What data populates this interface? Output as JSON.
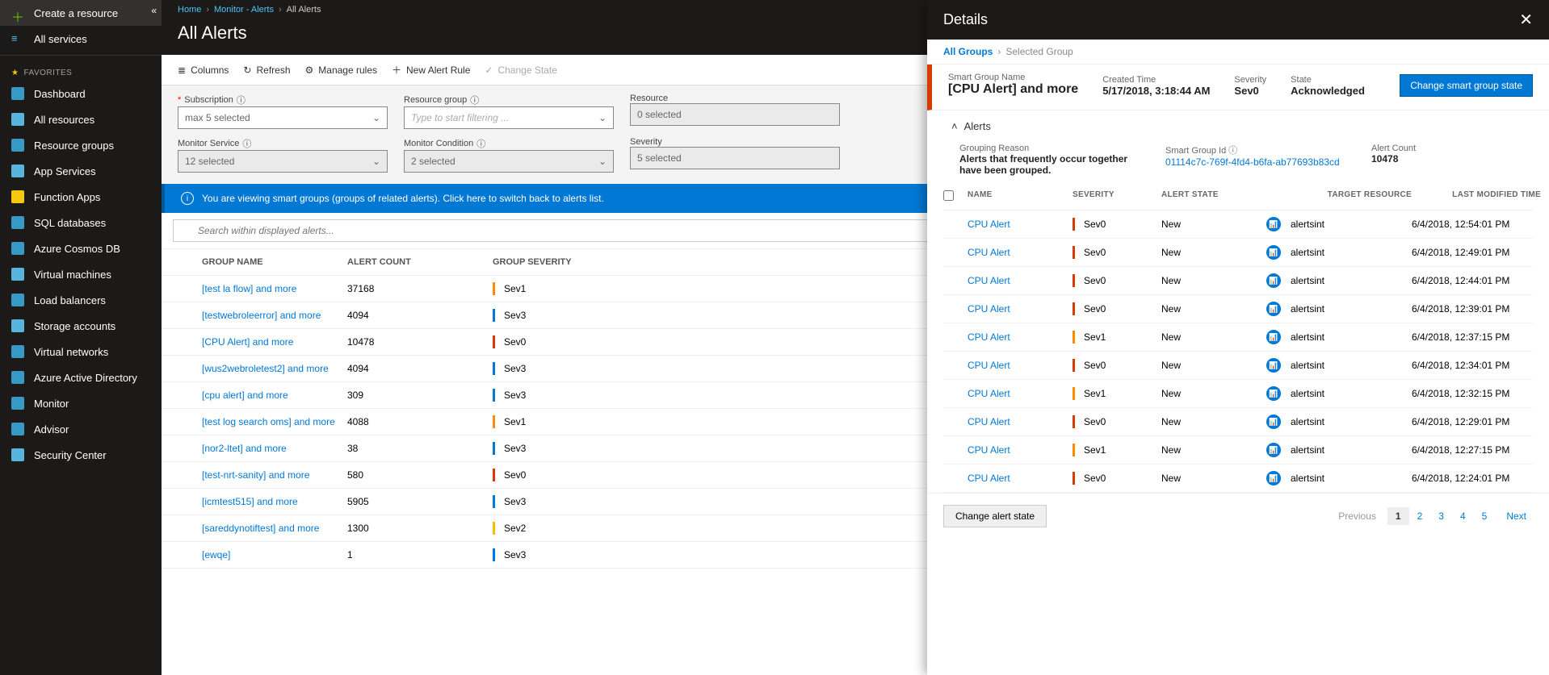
{
  "sidebar": {
    "create": "Create a resource",
    "all_services": "All services",
    "favorites": "FAVORITES",
    "items": [
      {
        "label": "Dashboard",
        "icon": "dashboard"
      },
      {
        "label": "All resources",
        "icon": "allres"
      },
      {
        "label": "Resource groups",
        "icon": "rg"
      },
      {
        "label": "App Services",
        "icon": "apps"
      },
      {
        "label": "Function Apps",
        "icon": "func"
      },
      {
        "label": "SQL databases",
        "icon": "sql"
      },
      {
        "label": "Azure Cosmos DB",
        "icon": "cosmos"
      },
      {
        "label": "Virtual machines",
        "icon": "vm"
      },
      {
        "label": "Load balancers",
        "icon": "lb"
      },
      {
        "label": "Storage accounts",
        "icon": "storage"
      },
      {
        "label": "Virtual networks",
        "icon": "vnet"
      },
      {
        "label": "Azure Active Directory",
        "icon": "aad"
      },
      {
        "label": "Monitor",
        "icon": "monitor"
      },
      {
        "label": "Advisor",
        "icon": "advisor"
      },
      {
        "label": "Security Center",
        "icon": "sec"
      }
    ]
  },
  "breadcrumb": {
    "items": [
      "Home",
      "Monitor - Alerts",
      "All Alerts"
    ]
  },
  "page_title": "All Alerts",
  "toolbar": {
    "columns": "Columns",
    "refresh": "Refresh",
    "manage": "Manage rules",
    "new_rule": "New Alert Rule",
    "change_state": "Change State"
  },
  "filters": {
    "subscription": {
      "label": "Subscription",
      "value": "max 5 selected",
      "required": true
    },
    "resource_group": {
      "label": "Resource group",
      "value": "Type to start filtering ..."
    },
    "resource": {
      "label": "Resource",
      "value": "0 selected"
    },
    "monitor_service": {
      "label": "Monitor Service",
      "value": "12 selected"
    },
    "monitor_condition": {
      "label": "Monitor Condition",
      "value": "2 selected"
    },
    "severity": {
      "label": "Severity",
      "value": "5 selected"
    }
  },
  "banner": "You are viewing smart groups (groups of related alerts). Click here to switch back to alerts list.",
  "search_placeholder": "Search within displayed alerts...",
  "grid": {
    "headers": {
      "name": "GROUP NAME",
      "count": "ALERT COUNT",
      "severity": "GROUP SEVERITY"
    },
    "rows": [
      {
        "name": "[test la flow] and more",
        "count": "37168",
        "sev": "Sev1",
        "cls": "sev1"
      },
      {
        "name": "[testwebroleerror] and more",
        "count": "4094",
        "sev": "Sev3",
        "cls": "sev3"
      },
      {
        "name": "[CPU Alert] and more",
        "count": "10478",
        "sev": "Sev0",
        "cls": "sev0"
      },
      {
        "name": "[wus2webroletest2] and more",
        "count": "4094",
        "sev": "Sev3",
        "cls": "sev3"
      },
      {
        "name": "[cpu alert] and more",
        "count": "309",
        "sev": "Sev3",
        "cls": "sev3"
      },
      {
        "name": "[test log search oms] and more",
        "count": "4088",
        "sev": "Sev1",
        "cls": "sev1"
      },
      {
        "name": "[nor2-ltet] and more",
        "count": "38",
        "sev": "Sev3",
        "cls": "sev3"
      },
      {
        "name": "[test-nrt-sanity] and more",
        "count": "580",
        "sev": "Sev0",
        "cls": "sev0"
      },
      {
        "name": "[icmtest515] and more",
        "count": "5905",
        "sev": "Sev3",
        "cls": "sev3"
      },
      {
        "name": "[sareddynotiftest] and more",
        "count": "1300",
        "sev": "Sev2",
        "cls": "sev2"
      },
      {
        "name": "[ewqe]",
        "count": "1",
        "sev": "Sev3",
        "cls": "sev3"
      }
    ]
  },
  "panel": {
    "title": "Details",
    "bc_all": "All Groups",
    "bc_cur": "Selected Group",
    "summary": {
      "name_label": "Smart Group Name",
      "name": "[CPU Alert] and more",
      "created_label": "Created Time",
      "created": "5/17/2018, 3:18:44 AM",
      "severity_label": "Severity",
      "severity": "Sev0",
      "state_label": "State",
      "state": "Acknowledged",
      "button": "Change smart group state"
    },
    "section": "Alerts",
    "meta": {
      "reason_label": "Grouping Reason",
      "reason": "Alerts that frequently occur together have been grouped.",
      "id_label": "Smart Group Id",
      "id": "01114c7c-769f-4fd4-b6fa-ab77693b83cd",
      "count_label": "Alert Count",
      "count": "10478"
    },
    "table": {
      "headers": {
        "name": "NAME",
        "sev": "SEVERITY",
        "state": "ALERT STATE",
        "target": "TARGET RESOURCE",
        "modified": "LAST MODIFIED TIME"
      },
      "rows": [
        {
          "name": "CPU Alert",
          "sev": "Sev0",
          "cls": "sev0",
          "state": "New",
          "target": "alertsint",
          "modified": "6/4/2018, 12:54:01 PM"
        },
        {
          "name": "CPU Alert",
          "sev": "Sev0",
          "cls": "sev0",
          "state": "New",
          "target": "alertsint",
          "modified": "6/4/2018, 12:49:01 PM"
        },
        {
          "name": "CPU Alert",
          "sev": "Sev0",
          "cls": "sev0",
          "state": "New",
          "target": "alertsint",
          "modified": "6/4/2018, 12:44:01 PM"
        },
        {
          "name": "CPU Alert",
          "sev": "Sev0",
          "cls": "sev0",
          "state": "New",
          "target": "alertsint",
          "modified": "6/4/2018, 12:39:01 PM"
        },
        {
          "name": "CPU Alert",
          "sev": "Sev1",
          "cls": "sev1",
          "state": "New",
          "target": "alertsint",
          "modified": "6/4/2018, 12:37:15 PM"
        },
        {
          "name": "CPU Alert",
          "sev": "Sev0",
          "cls": "sev0",
          "state": "New",
          "target": "alertsint",
          "modified": "6/4/2018, 12:34:01 PM"
        },
        {
          "name": "CPU Alert",
          "sev": "Sev1",
          "cls": "sev1",
          "state": "New",
          "target": "alertsint",
          "modified": "6/4/2018, 12:32:15 PM"
        },
        {
          "name": "CPU Alert",
          "sev": "Sev0",
          "cls": "sev0",
          "state": "New",
          "target": "alertsint",
          "modified": "6/4/2018, 12:29:01 PM"
        },
        {
          "name": "CPU Alert",
          "sev": "Sev1",
          "cls": "sev1",
          "state": "New",
          "target": "alertsint",
          "modified": "6/4/2018, 12:27:15 PM"
        },
        {
          "name": "CPU Alert",
          "sev": "Sev0",
          "cls": "sev0",
          "state": "New",
          "target": "alertsint",
          "modified": "6/4/2018, 12:24:01 PM"
        }
      ]
    },
    "footer": {
      "change_state": "Change alert state",
      "previous": "Previous",
      "next": "Next",
      "pages": [
        "1",
        "2",
        "3",
        "4",
        "5"
      ]
    }
  }
}
